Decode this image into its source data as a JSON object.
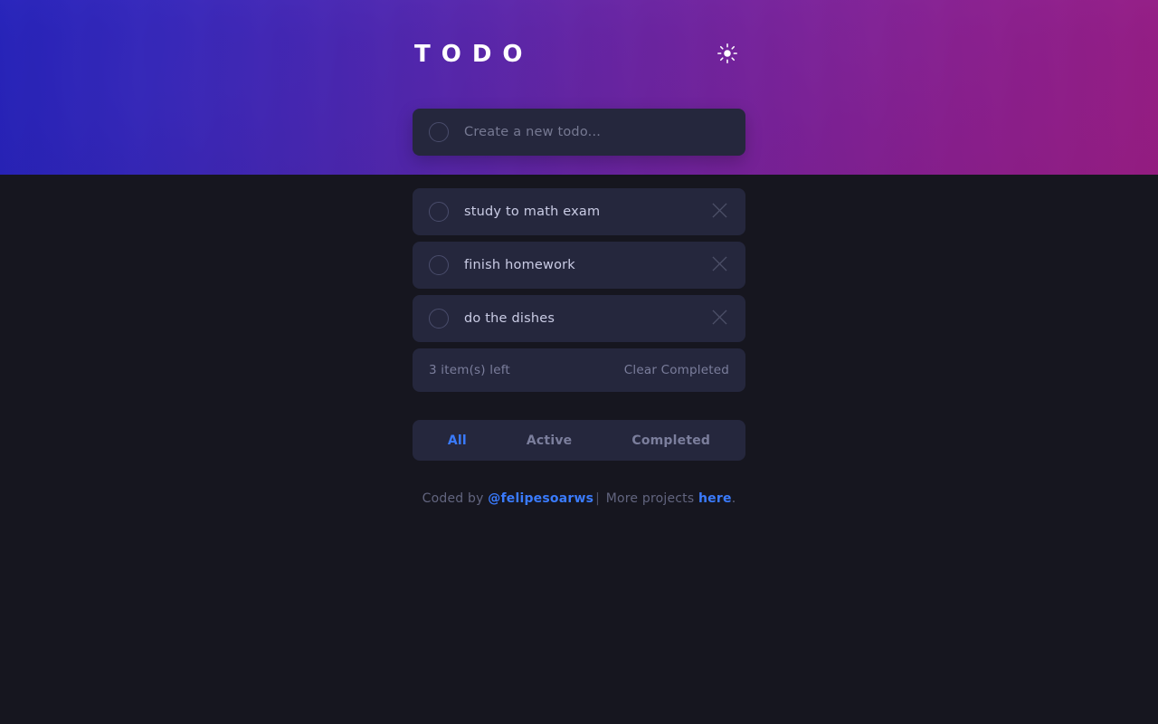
{
  "app": {
    "title": "TODO",
    "theme_toggle_icon": "sun-icon",
    "accent_color": "#3a7bfd",
    "card_color": "#25273d",
    "page_background": "#16161f"
  },
  "new_todo": {
    "placeholder": "Create a new todo...",
    "value": "",
    "checkbox_icon": "empty-circle-icon"
  },
  "todos": [
    {
      "label": "study to math exam",
      "completed": false,
      "delete_icon": "close-x-icon"
    },
    {
      "label": "finish homework",
      "completed": false,
      "delete_icon": "close-x-icon"
    },
    {
      "label": "do the dishes",
      "completed": false,
      "delete_icon": "close-x-icon"
    }
  ],
  "status": {
    "items_left": "3 item(s) left",
    "clear_label": "Clear Completed"
  },
  "filters": [
    {
      "label": "All",
      "active": true
    },
    {
      "label": "Active",
      "active": false
    },
    {
      "label": "Completed",
      "active": false
    }
  ],
  "footer": {
    "prefix": "Coded by ",
    "author": "@felipesoarws",
    "separator": "|",
    "middle": " More projects ",
    "link": "here",
    "suffix": "."
  }
}
